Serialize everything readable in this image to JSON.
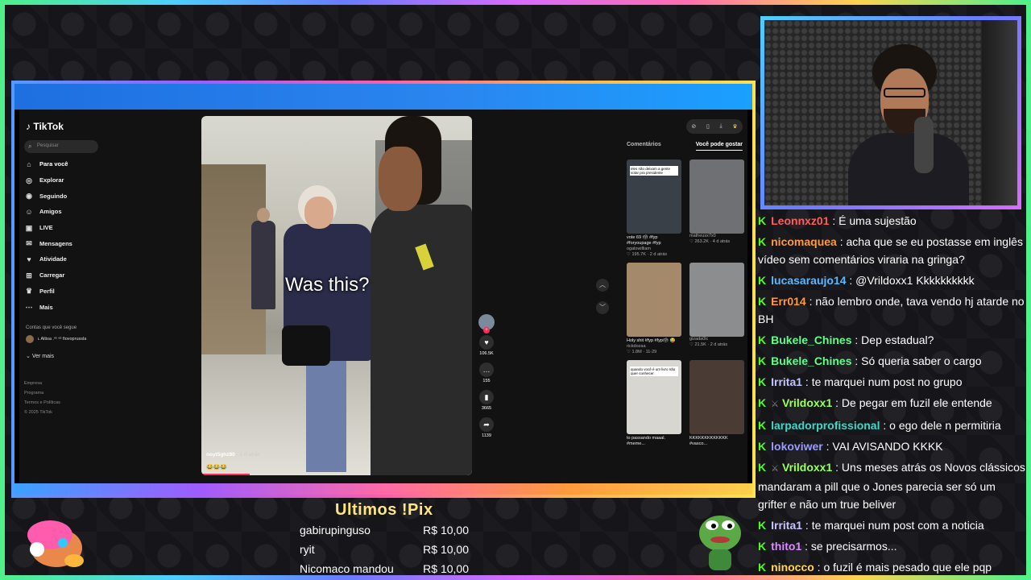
{
  "tiktok": {
    "logo": "TikTok",
    "search_placeholder": "Pesquisar",
    "nav": [
      {
        "label": "Para você",
        "icon": "home-icon"
      },
      {
        "label": "Explorar",
        "icon": "compass-icon"
      },
      {
        "label": "Seguindo",
        "icon": "following-icon"
      },
      {
        "label": "Amigos",
        "icon": "friends-icon"
      },
      {
        "label": "LIVE",
        "icon": "live-icon"
      },
      {
        "label": "Mensagens",
        "icon": "messages-icon"
      },
      {
        "label": "Atividade",
        "icon": "activity-icon"
      },
      {
        "label": "Carregar",
        "icon": "upload-icon"
      },
      {
        "label": "Perfil",
        "icon": "profile-icon"
      },
      {
        "label": "Mais",
        "icon": "more-icon"
      }
    ],
    "following_heading": "Contas que você segue",
    "following_account": "ʟ Altisa .ᵒᶜ ᵉˢ fiovoprussla",
    "see_more": "Ver mais",
    "footer": [
      "Empresa",
      "Programa",
      "Termos e Políticas",
      "© 2025 TikTok"
    ],
    "video": {
      "caption": "Was this?",
      "username": "noyt5ghz90",
      "time": " · 1 d atrás",
      "emojis": "😂😂😂",
      "likes": "106.5K",
      "comments": "155",
      "saves": "3665",
      "shares": "1139"
    },
    "right_panel": {
      "tabs": [
        "Comentários",
        "Você pode gostar"
      ],
      "cards": [
        {
          "desc": "vote 69 🗳 #fyp #foryoupage #fyp",
          "author": "ogalowilliam",
          "meta": "♡ 195.7K · 2 d atrás",
          "thumb": "#3a4048",
          "caption": "eles não deixam a gente votar pra presidente"
        },
        {
          "desc": "",
          "author": "matheusx7x0",
          "meta": "♡ 263.2K · 4 d atrás",
          "thumb": "#6e7074",
          "caption": ""
        },
        {
          "desc": "Holy shit #fyp #fyp🗳 😂",
          "author": "rickdozaa",
          "meta": "♡ 1.8M · 11-29",
          "thumb": "#a48a6a",
          "caption": ""
        },
        {
          "desc": "",
          "author": "gizada0lc",
          "meta": "♡ 21.5K · 2 d atrás",
          "thumb": "#8b8d8f",
          "caption": ""
        },
        {
          "desc": "to passando maaal. #meme...",
          "author": "",
          "meta": "",
          "thumb": "#d8d6d0",
          "caption": "quando você é um livro não quer conhecer"
        },
        {
          "desc": "KKKKKKKKKKKKK #vasco...",
          "author": "",
          "meta": "",
          "thumb": "#4a3c34",
          "caption": ""
        }
      ]
    }
  },
  "chat": [
    {
      "user": "Leonnxz01",
      "color": "#ff5c5c",
      "text": " : É uma sujestão",
      "badge": ""
    },
    {
      "user": "nicomaquea",
      "color": "#ff9a3d",
      "text": " : acha que se eu postasse em inglês vídeo sem comentários viraria na gringa?",
      "badge": ""
    },
    {
      "user": "lucasaraujo14",
      "color": "#5cb8ff",
      "text": " : @Vrildoxx1 Kkkkkkkkkk",
      "badge": ""
    },
    {
      "user": "Err014",
      "color": "#ff9a3d",
      "text": " : não lembro onde, tava vendo hj atarde no BH",
      "badge": ""
    },
    {
      "user": "Bukele_Chines",
      "color": "#5cff8a",
      "text": " : Dep estadual?",
      "badge": ""
    },
    {
      "user": "Bukele_Chines",
      "color": "#5cff8a",
      "text": " : Só queria saber o cargo",
      "badge": ""
    },
    {
      "user": "Irrita1",
      "color": "#c4c4ff",
      "text": " : te marquei num post no grupo",
      "badge": ""
    },
    {
      "user": "Vrildoxx1",
      "color": "#9cff5c",
      "text": " : De pegar em fuzil ele entende",
      "badge": "⚔"
    },
    {
      "user": "larpadorprofissional",
      "color": "#3dd9c8",
      "text": " : o ego dele n permitiria",
      "badge": ""
    },
    {
      "user": "lokoviwer",
      "color": "#9c9cff",
      "text": " : VAI AVISANDO KKKK",
      "badge": ""
    },
    {
      "user": "Vrildoxx1",
      "color": "#9cff5c",
      "text": " : Uns meses atrás os Novos clássicos mandaram a pill que o Jones parecia ser só um grifter e não um true beliver",
      "badge": "⚔"
    },
    {
      "user": "Irrita1",
      "color": "#c4c4ff",
      "text": " : te marquei num post com a noticia",
      "badge": ""
    },
    {
      "user": "thito1",
      "color": "#d98cff",
      "text": " : se precisarmos...",
      "badge": ""
    },
    {
      "user": "ninocco",
      "color": "#ffd84d",
      "text": " : o fuzil é mais pesado que ele pqp",
      "badge": ""
    }
  ],
  "pix": {
    "title": "Ultimos !Pix",
    "entries": [
      {
        "name": "gabirupinguso",
        "amount": "R$ 10,00"
      },
      {
        "name": "ryit",
        "amount": "R$ 10,00"
      },
      {
        "name": "Nicomaco mandou",
        "amount": "R$ 10,00"
      }
    ]
  }
}
